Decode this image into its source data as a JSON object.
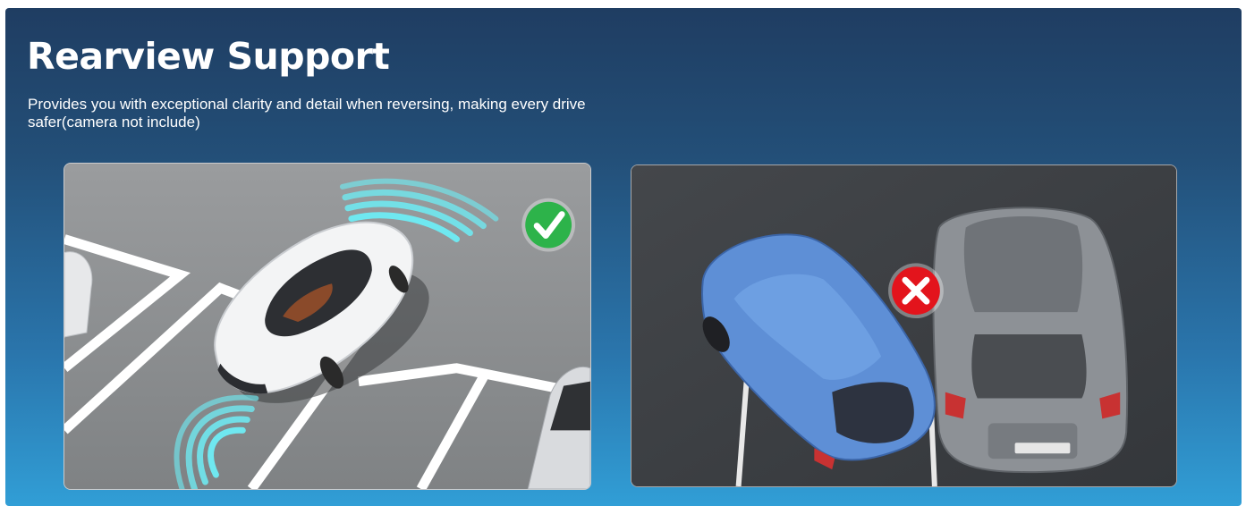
{
  "header": {
    "title": "Rearview Support",
    "subtitle": "Provides you with exceptional clarity and detail when reversing, making every drive safer(camera not include)"
  },
  "images": [
    {
      "name": "correct-parking-illustration",
      "badge": "check-icon",
      "badge_color": "#2db34a"
    },
    {
      "name": "incorrect-parking-illustration",
      "badge": "close-icon",
      "badge_color": "#e3141c"
    }
  ],
  "colors": {
    "accent_waves": "#6fe8f0",
    "banner_top": "#1f3d62",
    "banner_bottom": "#319ed6"
  }
}
